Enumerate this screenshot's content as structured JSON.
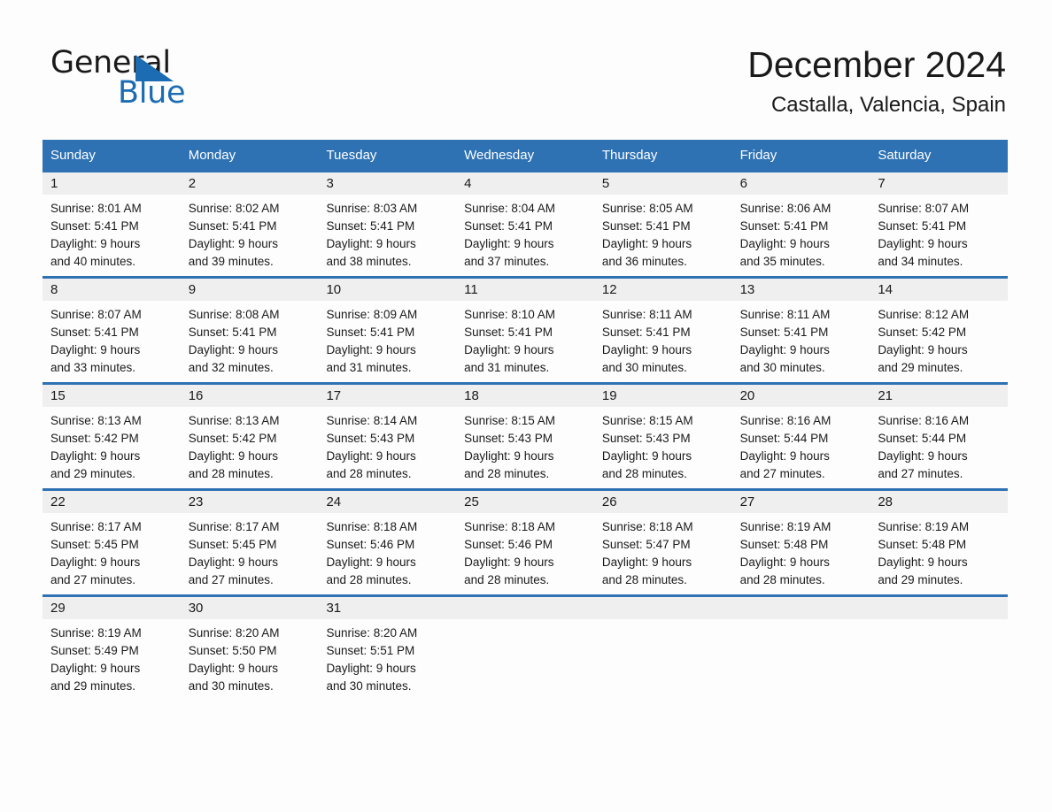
{
  "brand": {
    "name_part1": "General",
    "name_part2": "Blue",
    "triangle_color": "#1b6cb3"
  },
  "header": {
    "title": "December 2024",
    "subtitle": "Castalla, Valencia, Spain"
  },
  "theme": {
    "header_blue": "#2e72b4",
    "day_band_gray": "#efefef",
    "page_bg": "#fdfdfd",
    "text": "#1a1a1a"
  },
  "weekdays": [
    "Sunday",
    "Monday",
    "Tuesday",
    "Wednesday",
    "Thursday",
    "Friday",
    "Saturday"
  ],
  "weeks": [
    [
      {
        "day": "1",
        "sunrise": "Sunrise: 8:01 AM",
        "sunset": "Sunset: 5:41 PM",
        "daylight1": "Daylight: 9 hours",
        "daylight2": "and 40 minutes."
      },
      {
        "day": "2",
        "sunrise": "Sunrise: 8:02 AM",
        "sunset": "Sunset: 5:41 PM",
        "daylight1": "Daylight: 9 hours",
        "daylight2": "and 39 minutes."
      },
      {
        "day": "3",
        "sunrise": "Sunrise: 8:03 AM",
        "sunset": "Sunset: 5:41 PM",
        "daylight1": "Daylight: 9 hours",
        "daylight2": "and 38 minutes."
      },
      {
        "day": "4",
        "sunrise": "Sunrise: 8:04 AM",
        "sunset": "Sunset: 5:41 PM",
        "daylight1": "Daylight: 9 hours",
        "daylight2": "and 37 minutes."
      },
      {
        "day": "5",
        "sunrise": "Sunrise: 8:05 AM",
        "sunset": "Sunset: 5:41 PM",
        "daylight1": "Daylight: 9 hours",
        "daylight2": "and 36 minutes."
      },
      {
        "day": "6",
        "sunrise": "Sunrise: 8:06 AM",
        "sunset": "Sunset: 5:41 PM",
        "daylight1": "Daylight: 9 hours",
        "daylight2": "and 35 minutes."
      },
      {
        "day": "7",
        "sunrise": "Sunrise: 8:07 AM",
        "sunset": "Sunset: 5:41 PM",
        "daylight1": "Daylight: 9 hours",
        "daylight2": "and 34 minutes."
      }
    ],
    [
      {
        "day": "8",
        "sunrise": "Sunrise: 8:07 AM",
        "sunset": "Sunset: 5:41 PM",
        "daylight1": "Daylight: 9 hours",
        "daylight2": "and 33 minutes."
      },
      {
        "day": "9",
        "sunrise": "Sunrise: 8:08 AM",
        "sunset": "Sunset: 5:41 PM",
        "daylight1": "Daylight: 9 hours",
        "daylight2": "and 32 minutes."
      },
      {
        "day": "10",
        "sunrise": "Sunrise: 8:09 AM",
        "sunset": "Sunset: 5:41 PM",
        "daylight1": "Daylight: 9 hours",
        "daylight2": "and 31 minutes."
      },
      {
        "day": "11",
        "sunrise": "Sunrise: 8:10 AM",
        "sunset": "Sunset: 5:41 PM",
        "daylight1": "Daylight: 9 hours",
        "daylight2": "and 31 minutes."
      },
      {
        "day": "12",
        "sunrise": "Sunrise: 8:11 AM",
        "sunset": "Sunset: 5:41 PM",
        "daylight1": "Daylight: 9 hours",
        "daylight2": "and 30 minutes."
      },
      {
        "day": "13",
        "sunrise": "Sunrise: 8:11 AM",
        "sunset": "Sunset: 5:41 PM",
        "daylight1": "Daylight: 9 hours",
        "daylight2": "and 30 minutes."
      },
      {
        "day": "14",
        "sunrise": "Sunrise: 8:12 AM",
        "sunset": "Sunset: 5:42 PM",
        "daylight1": "Daylight: 9 hours",
        "daylight2": "and 29 minutes."
      }
    ],
    [
      {
        "day": "15",
        "sunrise": "Sunrise: 8:13 AM",
        "sunset": "Sunset: 5:42 PM",
        "daylight1": "Daylight: 9 hours",
        "daylight2": "and 29 minutes."
      },
      {
        "day": "16",
        "sunrise": "Sunrise: 8:13 AM",
        "sunset": "Sunset: 5:42 PM",
        "daylight1": "Daylight: 9 hours",
        "daylight2": "and 28 minutes."
      },
      {
        "day": "17",
        "sunrise": "Sunrise: 8:14 AM",
        "sunset": "Sunset: 5:43 PM",
        "daylight1": "Daylight: 9 hours",
        "daylight2": "and 28 minutes."
      },
      {
        "day": "18",
        "sunrise": "Sunrise: 8:15 AM",
        "sunset": "Sunset: 5:43 PM",
        "daylight1": "Daylight: 9 hours",
        "daylight2": "and 28 minutes."
      },
      {
        "day": "19",
        "sunrise": "Sunrise: 8:15 AM",
        "sunset": "Sunset: 5:43 PM",
        "daylight1": "Daylight: 9 hours",
        "daylight2": "and 28 minutes."
      },
      {
        "day": "20",
        "sunrise": "Sunrise: 8:16 AM",
        "sunset": "Sunset: 5:44 PM",
        "daylight1": "Daylight: 9 hours",
        "daylight2": "and 27 minutes."
      },
      {
        "day": "21",
        "sunrise": "Sunrise: 8:16 AM",
        "sunset": "Sunset: 5:44 PM",
        "daylight1": "Daylight: 9 hours",
        "daylight2": "and 27 minutes."
      }
    ],
    [
      {
        "day": "22",
        "sunrise": "Sunrise: 8:17 AM",
        "sunset": "Sunset: 5:45 PM",
        "daylight1": "Daylight: 9 hours",
        "daylight2": "and 27 minutes."
      },
      {
        "day": "23",
        "sunrise": "Sunrise: 8:17 AM",
        "sunset": "Sunset: 5:45 PM",
        "daylight1": "Daylight: 9 hours",
        "daylight2": "and 27 minutes."
      },
      {
        "day": "24",
        "sunrise": "Sunrise: 8:18 AM",
        "sunset": "Sunset: 5:46 PM",
        "daylight1": "Daylight: 9 hours",
        "daylight2": "and 28 minutes."
      },
      {
        "day": "25",
        "sunrise": "Sunrise: 8:18 AM",
        "sunset": "Sunset: 5:46 PM",
        "daylight1": "Daylight: 9 hours",
        "daylight2": "and 28 minutes."
      },
      {
        "day": "26",
        "sunrise": "Sunrise: 8:18 AM",
        "sunset": "Sunset: 5:47 PM",
        "daylight1": "Daylight: 9 hours",
        "daylight2": "and 28 minutes."
      },
      {
        "day": "27",
        "sunrise": "Sunrise: 8:19 AM",
        "sunset": "Sunset: 5:48 PM",
        "daylight1": "Daylight: 9 hours",
        "daylight2": "and 28 minutes."
      },
      {
        "day": "28",
        "sunrise": "Sunrise: 8:19 AM",
        "sunset": "Sunset: 5:48 PM",
        "daylight1": "Daylight: 9 hours",
        "daylight2": "and 29 minutes."
      }
    ],
    [
      {
        "day": "29",
        "sunrise": "Sunrise: 8:19 AM",
        "sunset": "Sunset: 5:49 PM",
        "daylight1": "Daylight: 9 hours",
        "daylight2": "and 29 minutes."
      },
      {
        "day": "30",
        "sunrise": "Sunrise: 8:20 AM",
        "sunset": "Sunset: 5:50 PM",
        "daylight1": "Daylight: 9 hours",
        "daylight2": "and 30 minutes."
      },
      {
        "day": "31",
        "sunrise": "Sunrise: 8:20 AM",
        "sunset": "Sunset: 5:51 PM",
        "daylight1": "Daylight: 9 hours",
        "daylight2": "and 30 minutes."
      },
      {
        "day": "",
        "sunrise": "",
        "sunset": "",
        "daylight1": "",
        "daylight2": ""
      },
      {
        "day": "",
        "sunrise": "",
        "sunset": "",
        "daylight1": "",
        "daylight2": ""
      },
      {
        "day": "",
        "sunrise": "",
        "sunset": "",
        "daylight1": "",
        "daylight2": ""
      },
      {
        "day": "",
        "sunrise": "",
        "sunset": "",
        "daylight1": "",
        "daylight2": ""
      }
    ]
  ]
}
